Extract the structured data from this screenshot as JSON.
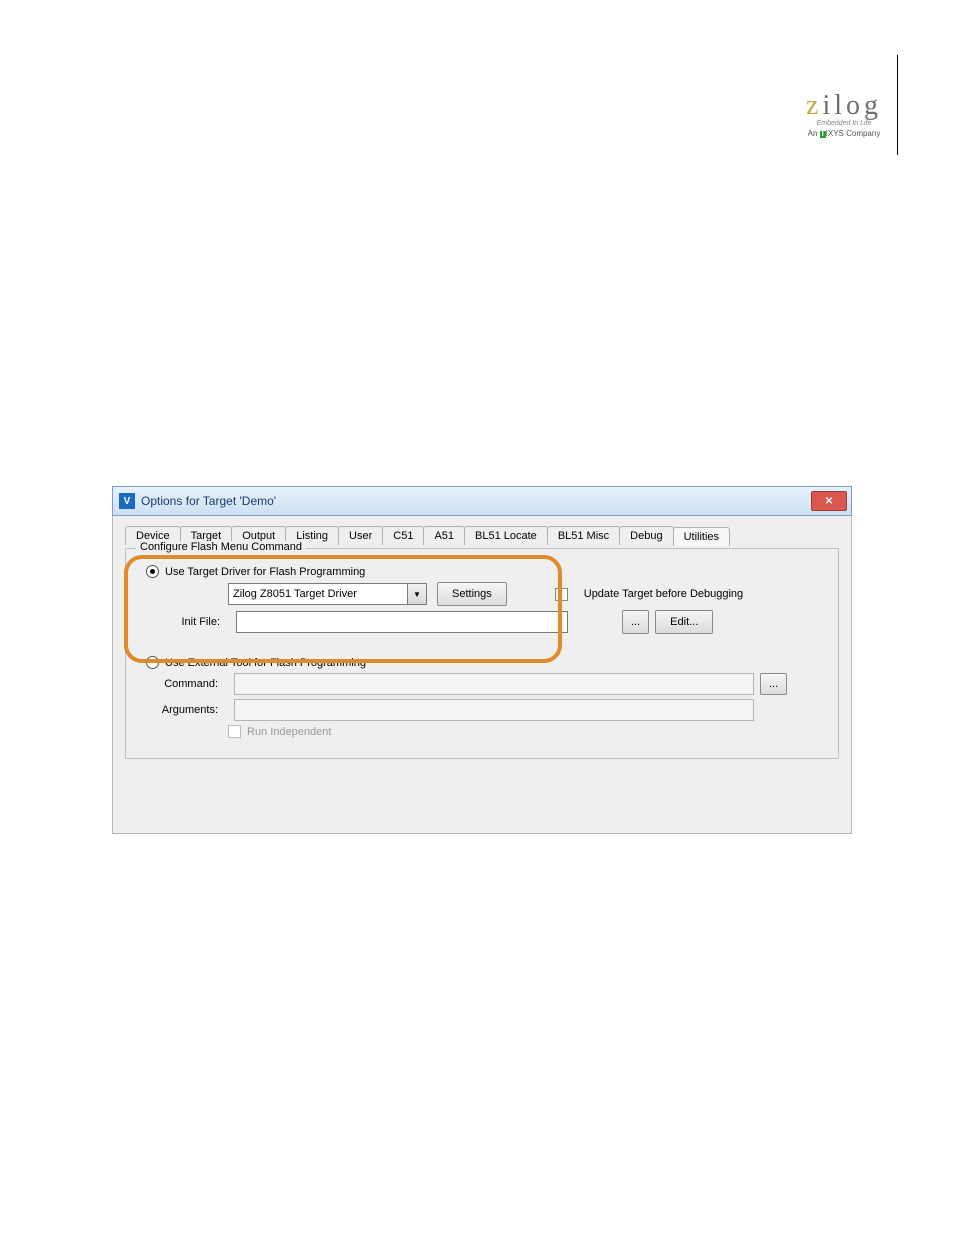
{
  "logo": {
    "brand_first": "z",
    "brand_rest": "ilog",
    "sub": "Embedded In Life",
    "ixys_prefix": "An",
    "ixys_box": "I",
    "ixys_rest": "IXYS Company"
  },
  "dialog": {
    "title": "Options for Target 'Demo'",
    "close_glyph": "✕",
    "tabs": [
      "Device",
      "Target",
      "Output",
      "Listing",
      "User",
      "C51",
      "A51",
      "BL51 Locate",
      "BL51 Misc",
      "Debug",
      "Utilities"
    ],
    "active_tab": "Utilities",
    "group_legend": "Configure Flash Menu Command",
    "radio1": "Use Target Driver for Flash Programming",
    "driver_value": "Zilog Z8051 Target Driver",
    "settings_btn": "Settings",
    "update_ck": "Update Target before Debugging",
    "init_label": "Init File:",
    "init_value": "",
    "browse": "...",
    "edit_btn": "Edit...",
    "radio2": "Use External Tool for Flash Programming",
    "cmd_label": "Command:",
    "cmd_value": "",
    "args_label": "Arguments:",
    "args_value": "",
    "runind": "Run Independent"
  }
}
